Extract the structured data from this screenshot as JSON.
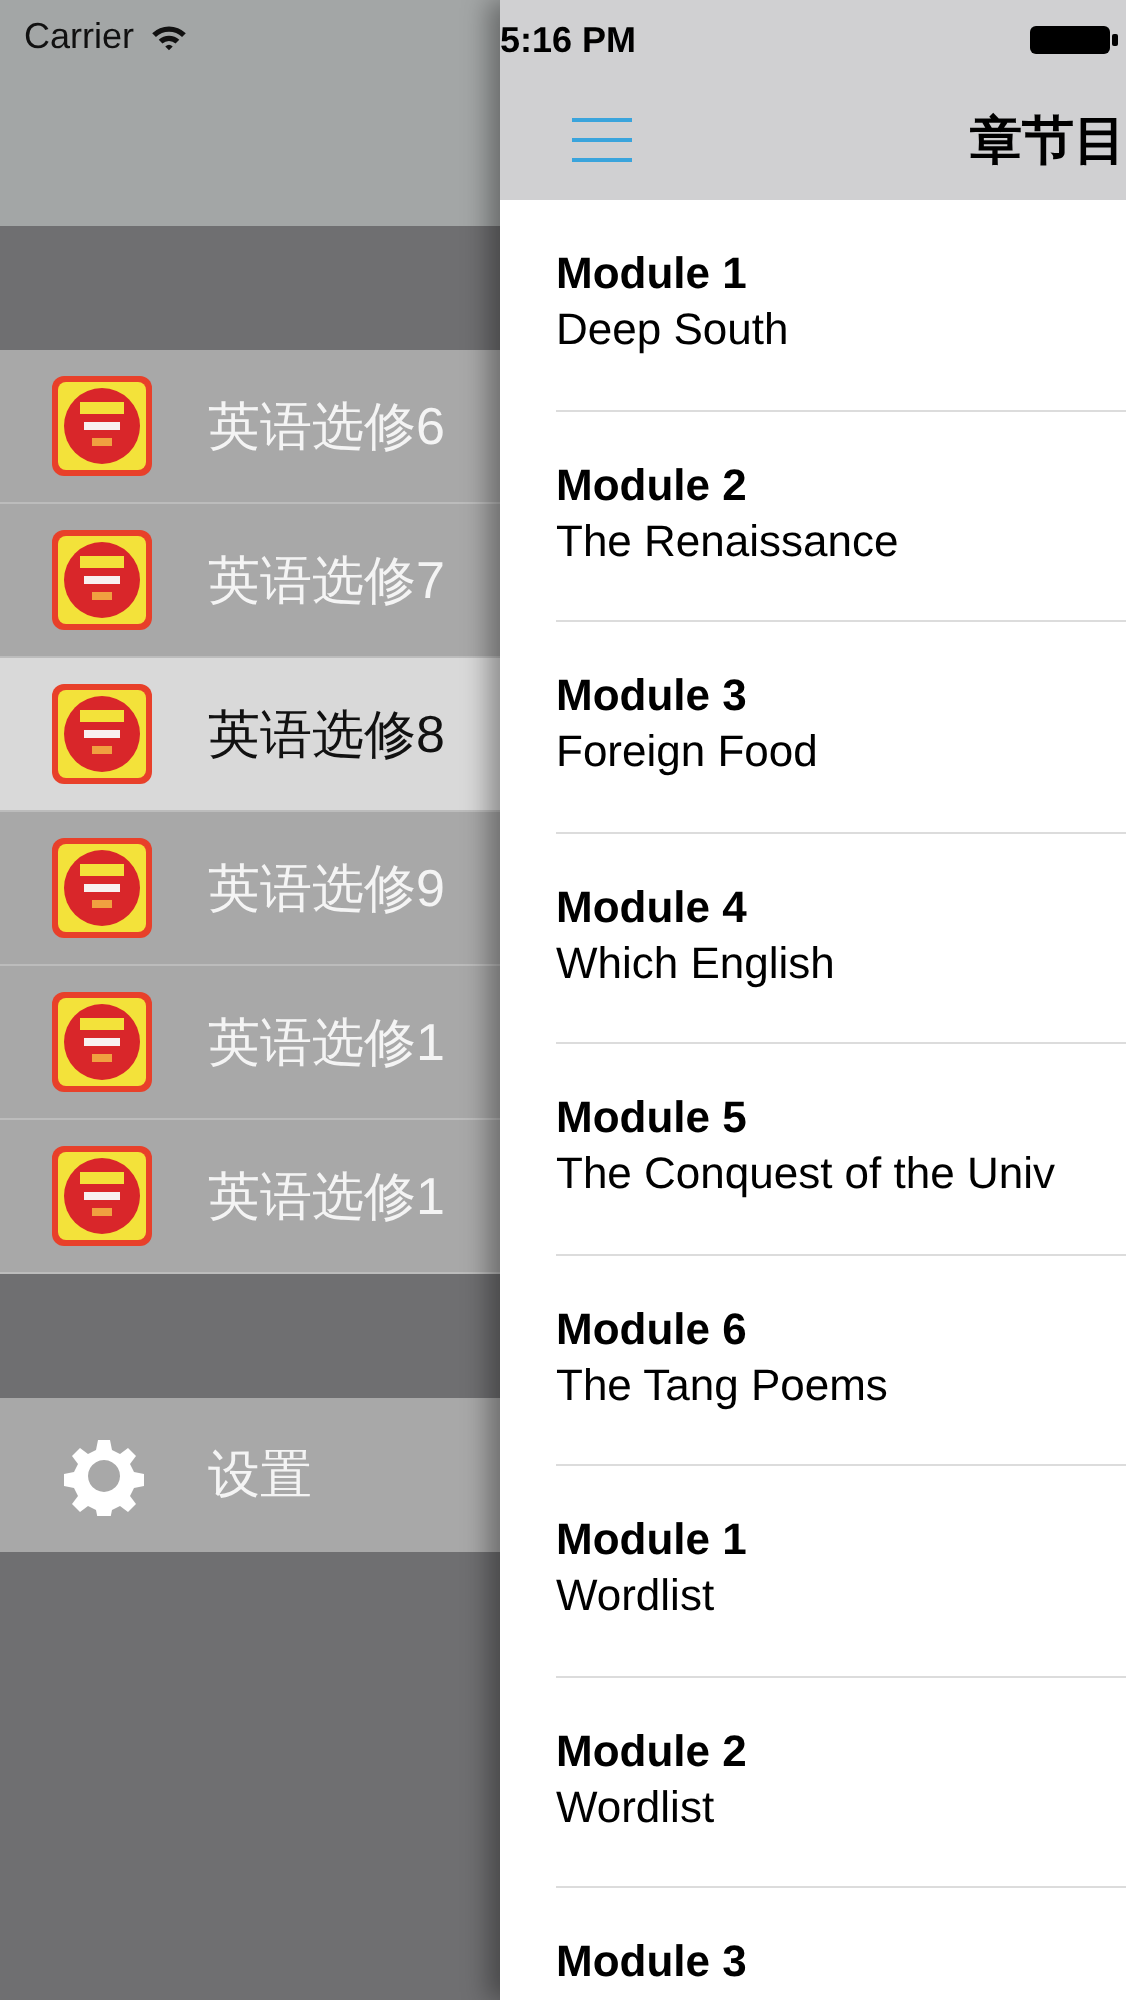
{
  "status_bar": {
    "carrier": "Carrier",
    "time": "5:16 PM"
  },
  "menu": {
    "items": [
      {
        "label": "英语选修6",
        "selected": false
      },
      {
        "label": "英语选修7",
        "selected": false
      },
      {
        "label": "英语选修8",
        "selected": true
      },
      {
        "label": "英语选修9",
        "selected": false
      },
      {
        "label": "英语选修1",
        "selected": false
      },
      {
        "label": "英语选修1",
        "selected": false
      }
    ],
    "settings": {
      "label": "设置"
    }
  },
  "nav_bar": {
    "title": "章节目"
  },
  "chapters": [
    {
      "module": "Module 1",
      "title": "Deep South"
    },
    {
      "module": "Module 2",
      "title": "The Renaissance"
    },
    {
      "module": "Module 3",
      "title": "Foreign Food"
    },
    {
      "module": "Module 4",
      "title": "Which English"
    },
    {
      "module": "Module 5",
      "title": "The Conquest of the Univ"
    },
    {
      "module": "Module 6",
      "title": "The Tang Poems"
    },
    {
      "module": "Module 1",
      "title": "Wordlist"
    },
    {
      "module": "Module 2",
      "title": "Wordlist"
    },
    {
      "module": "Module 3"
    }
  ]
}
